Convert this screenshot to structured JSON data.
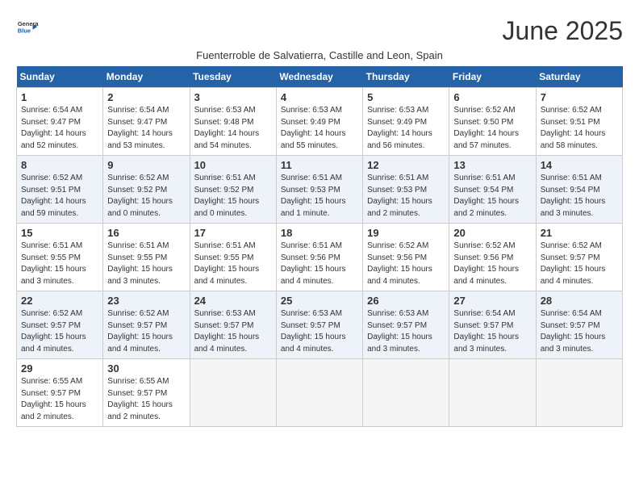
{
  "header": {
    "logo_line1": "General",
    "logo_line2": "Blue",
    "month": "June 2025",
    "location": "Fuenterroble de Salvatierra, Castille and Leon, Spain"
  },
  "weekdays": [
    "Sunday",
    "Monday",
    "Tuesday",
    "Wednesday",
    "Thursday",
    "Friday",
    "Saturday"
  ],
  "weeks": [
    [
      {
        "day": "1",
        "detail": "Sunrise: 6:54 AM\nSunset: 9:47 PM\nDaylight: 14 hours\nand 52 minutes."
      },
      {
        "day": "2",
        "detail": "Sunrise: 6:54 AM\nSunset: 9:47 PM\nDaylight: 14 hours\nand 53 minutes."
      },
      {
        "day": "3",
        "detail": "Sunrise: 6:53 AM\nSunset: 9:48 PM\nDaylight: 14 hours\nand 54 minutes."
      },
      {
        "day": "4",
        "detail": "Sunrise: 6:53 AM\nSunset: 9:49 PM\nDaylight: 14 hours\nand 55 minutes."
      },
      {
        "day": "5",
        "detail": "Sunrise: 6:53 AM\nSunset: 9:49 PM\nDaylight: 14 hours\nand 56 minutes."
      },
      {
        "day": "6",
        "detail": "Sunrise: 6:52 AM\nSunset: 9:50 PM\nDaylight: 14 hours\nand 57 minutes."
      },
      {
        "day": "7",
        "detail": "Sunrise: 6:52 AM\nSunset: 9:51 PM\nDaylight: 14 hours\nand 58 minutes."
      }
    ],
    [
      {
        "day": "8",
        "detail": "Sunrise: 6:52 AM\nSunset: 9:51 PM\nDaylight: 14 hours\nand 59 minutes."
      },
      {
        "day": "9",
        "detail": "Sunrise: 6:52 AM\nSunset: 9:52 PM\nDaylight: 15 hours\nand 0 minutes."
      },
      {
        "day": "10",
        "detail": "Sunrise: 6:51 AM\nSunset: 9:52 PM\nDaylight: 15 hours\nand 0 minutes."
      },
      {
        "day": "11",
        "detail": "Sunrise: 6:51 AM\nSunset: 9:53 PM\nDaylight: 15 hours\nand 1 minute."
      },
      {
        "day": "12",
        "detail": "Sunrise: 6:51 AM\nSunset: 9:53 PM\nDaylight: 15 hours\nand 2 minutes."
      },
      {
        "day": "13",
        "detail": "Sunrise: 6:51 AM\nSunset: 9:54 PM\nDaylight: 15 hours\nand 2 minutes."
      },
      {
        "day": "14",
        "detail": "Sunrise: 6:51 AM\nSunset: 9:54 PM\nDaylight: 15 hours\nand 3 minutes."
      }
    ],
    [
      {
        "day": "15",
        "detail": "Sunrise: 6:51 AM\nSunset: 9:55 PM\nDaylight: 15 hours\nand 3 minutes."
      },
      {
        "day": "16",
        "detail": "Sunrise: 6:51 AM\nSunset: 9:55 PM\nDaylight: 15 hours\nand 3 minutes."
      },
      {
        "day": "17",
        "detail": "Sunrise: 6:51 AM\nSunset: 9:55 PM\nDaylight: 15 hours\nand 4 minutes."
      },
      {
        "day": "18",
        "detail": "Sunrise: 6:51 AM\nSunset: 9:56 PM\nDaylight: 15 hours\nand 4 minutes."
      },
      {
        "day": "19",
        "detail": "Sunrise: 6:52 AM\nSunset: 9:56 PM\nDaylight: 15 hours\nand 4 minutes."
      },
      {
        "day": "20",
        "detail": "Sunrise: 6:52 AM\nSunset: 9:56 PM\nDaylight: 15 hours\nand 4 minutes."
      },
      {
        "day": "21",
        "detail": "Sunrise: 6:52 AM\nSunset: 9:57 PM\nDaylight: 15 hours\nand 4 minutes."
      }
    ],
    [
      {
        "day": "22",
        "detail": "Sunrise: 6:52 AM\nSunset: 9:57 PM\nDaylight: 15 hours\nand 4 minutes."
      },
      {
        "day": "23",
        "detail": "Sunrise: 6:52 AM\nSunset: 9:57 PM\nDaylight: 15 hours\nand 4 minutes."
      },
      {
        "day": "24",
        "detail": "Sunrise: 6:53 AM\nSunset: 9:57 PM\nDaylight: 15 hours\nand 4 minutes."
      },
      {
        "day": "25",
        "detail": "Sunrise: 6:53 AM\nSunset: 9:57 PM\nDaylight: 15 hours\nand 4 minutes."
      },
      {
        "day": "26",
        "detail": "Sunrise: 6:53 AM\nSunset: 9:57 PM\nDaylight: 15 hours\nand 3 minutes."
      },
      {
        "day": "27",
        "detail": "Sunrise: 6:54 AM\nSunset: 9:57 PM\nDaylight: 15 hours\nand 3 minutes."
      },
      {
        "day": "28",
        "detail": "Sunrise: 6:54 AM\nSunset: 9:57 PM\nDaylight: 15 hours\nand 3 minutes."
      }
    ],
    [
      {
        "day": "29",
        "detail": "Sunrise: 6:55 AM\nSunset: 9:57 PM\nDaylight: 15 hours\nand 2 minutes."
      },
      {
        "day": "30",
        "detail": "Sunrise: 6:55 AM\nSunset: 9:57 PM\nDaylight: 15 hours\nand 2 minutes."
      },
      {
        "day": "",
        "detail": ""
      },
      {
        "day": "",
        "detail": ""
      },
      {
        "day": "",
        "detail": ""
      },
      {
        "day": "",
        "detail": ""
      },
      {
        "day": "",
        "detail": ""
      }
    ]
  ]
}
